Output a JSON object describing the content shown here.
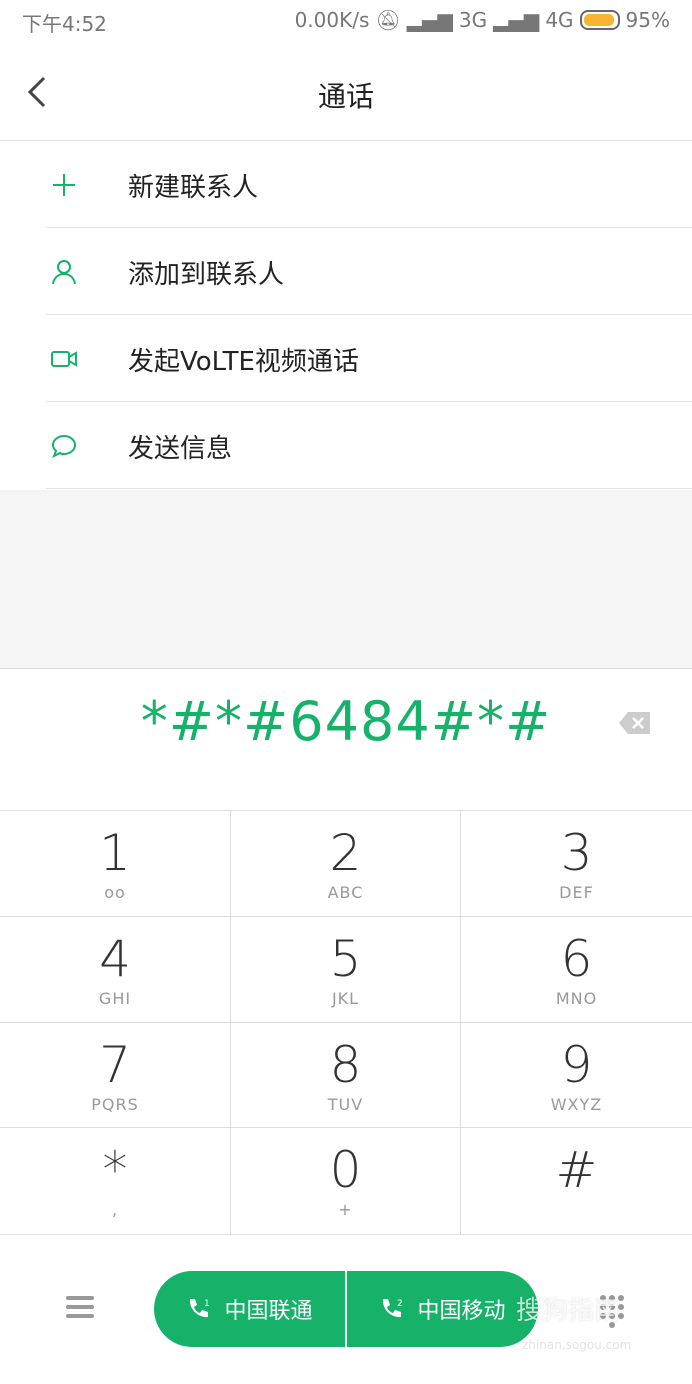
{
  "status_bar": {
    "time": "下午4:52",
    "speed": "0.00K/s",
    "net1": "3G",
    "net2": "4G",
    "battery": "95%",
    "battery_level": 0.95
  },
  "header": {
    "title": "通话"
  },
  "menu": [
    {
      "label": "新建联系人",
      "icon": "plus-icon"
    },
    {
      "label": "添加到联系人",
      "icon": "person-icon"
    },
    {
      "label": "发起VoLTE视频通话",
      "icon": "video-icon"
    },
    {
      "label": "发送信息",
      "icon": "message-icon"
    }
  ],
  "dialer": {
    "number": "*#*#6484#*#"
  },
  "keys": [
    {
      "d": "1",
      "s": "ᴏᴏ"
    },
    {
      "d": "2",
      "s": "ABC"
    },
    {
      "d": "3",
      "s": "DEF"
    },
    {
      "d": "4",
      "s": "GHI"
    },
    {
      "d": "5",
      "s": "JKL"
    },
    {
      "d": "6",
      "s": "MNO"
    },
    {
      "d": "7",
      "s": "PQRS"
    },
    {
      "d": "8",
      "s": "TUV"
    },
    {
      "d": "9",
      "s": "WXYZ"
    },
    {
      "d": "*",
      "s": ","
    },
    {
      "d": "0",
      "s": "+"
    },
    {
      "d": "#",
      "s": ""
    }
  ],
  "sims": [
    {
      "label": "中国联通",
      "slot": "1"
    },
    {
      "label": "中国移动",
      "slot": "2"
    }
  ],
  "colors": {
    "accent": "#17b26a",
    "battery": "#f6b531"
  },
  "watermark": {
    "text": "搜狗指南",
    "url": "zhinan.sogou.com"
  }
}
